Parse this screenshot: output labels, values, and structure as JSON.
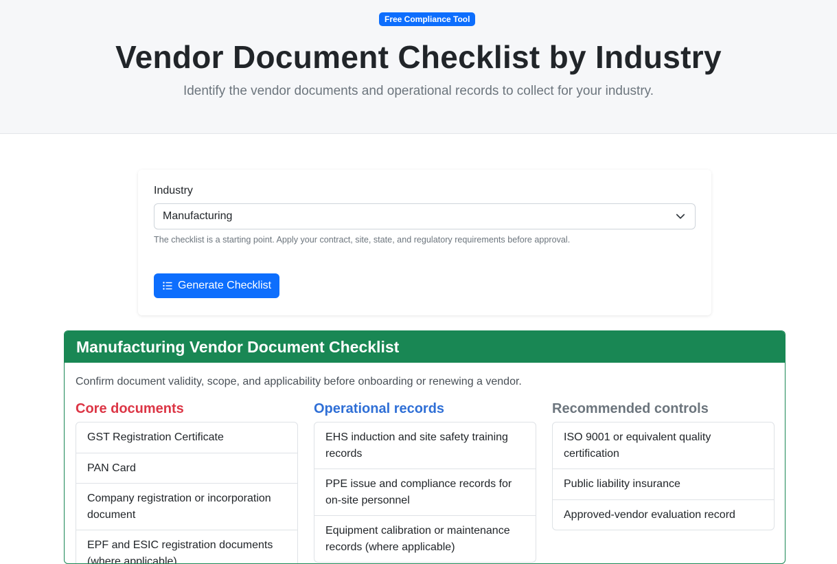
{
  "hero": {
    "badge": "Free Compliance Tool",
    "title": "Vendor Document Checklist by Industry",
    "subtitle": "Identify the vendor documents and operational records to collect for your industry."
  },
  "form": {
    "industry_label": "Industry",
    "industry_value": "Manufacturing",
    "help_text": "The checklist is a starting point. Apply your contract, site, state, and regulatory requirements before approval.",
    "generate_label": "Generate Checklist",
    "generate_icon": "list-icon",
    "select_icon": "chevron-down-icon"
  },
  "result": {
    "title": "Manufacturing Vendor Document Checklist",
    "note": "Confirm document validity, scope, and applicability before onboarding or renewing a vendor.",
    "columns": [
      {
        "title": "Core documents",
        "color": "#dc3545",
        "items": [
          "GST Registration Certificate",
          "PAN Card",
          "Company registration or incorporation document",
          "EPF and ESIC registration documents (where applicable)"
        ]
      },
      {
        "title": "Operational records",
        "color": "#2f6fd6",
        "items": [
          "EHS induction and site safety training records",
          "PPE issue and compliance records for on-site personnel",
          "Equipment calibration or maintenance records (where applicable)"
        ]
      },
      {
        "title": "Recommended controls",
        "color": "#6c757d",
        "items": [
          "ISO 9001 or equivalent quality certification",
          "Public liability insurance",
          "Approved-vendor evaluation record"
        ]
      }
    ]
  },
  "colors": {
    "primary": "#0d6efd",
    "success": "#198754"
  }
}
